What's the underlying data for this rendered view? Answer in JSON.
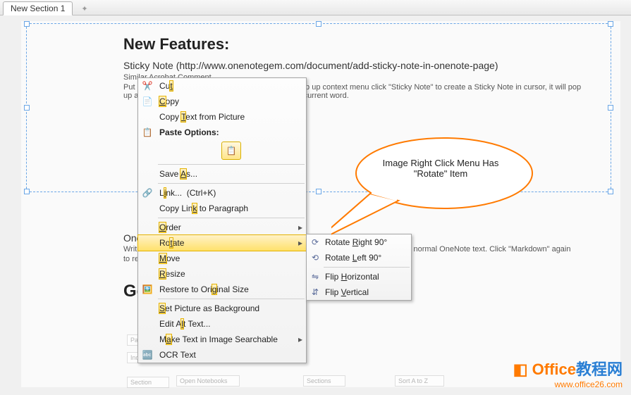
{
  "tab": {
    "label": "New Section 1"
  },
  "headings": {
    "features": "New Features:",
    "gem": "Gem"
  },
  "sticky": {
    "title": "Sticky Note (http://www.onenotegem.com/document/add-sticky-note-in-onenote-page)",
    "sub": "Similar Acrobat Comment.",
    "desc": "Put cursor in OneNote page, right click mouse, on pop up context menu click \"Sticky Note\" to create a Sticky Note in cursor, it will pop",
    "desc2": "up a memo to help you write something to comment current word."
  },
  "markdown": {
    "title_prefix": "OneNote",
    "title": "OneNote Markdown",
    "prefix": "Write Markdo",
    "suffix": "vert Markdown text to normal OneNote text. Click \"Markdown\" again",
    "line2_prefix": "to reconvert n"
  },
  "menu": {
    "cut": "Cut",
    "copy": "Copy",
    "copy_text": "Copy Text from Picture",
    "paste_options": "Paste Options:",
    "save_as": "Save As...",
    "link": "Link...",
    "link_accel": "(Ctrl+K)",
    "copy_link_para": "Copy Link to Paragraph",
    "order": "Order",
    "rotate": "Rotate",
    "move": "Move",
    "resize": "Resize",
    "restore": "Restore to Original Size",
    "set_bg": "Set Picture as Background",
    "alt_text": "Edit Alt Text...",
    "make_search": "Make Text in Image Searchable",
    "ocr": "OCR Text"
  },
  "submenu": {
    "rotate_right": "Rotate Right 90°",
    "rotate_left": "Rotate Left 90°",
    "flip_h": "Flip Horizontal",
    "flip_v": "Flip Vertical"
  },
  "callout": {
    "line1": "Image Right Click Menu Has",
    "line2": "\"Rotate\" Item"
  },
  "logo": {
    "text1": "Office",
    "text2": "教程网",
    "url": "www.office26.com"
  },
  "bg": {
    "page": "Page",
    "inden": "Inden",
    "sect": "Section",
    "open_nb": "Open Notebooks",
    "sections": "Sections",
    "sort": "Sort A to Z"
  }
}
